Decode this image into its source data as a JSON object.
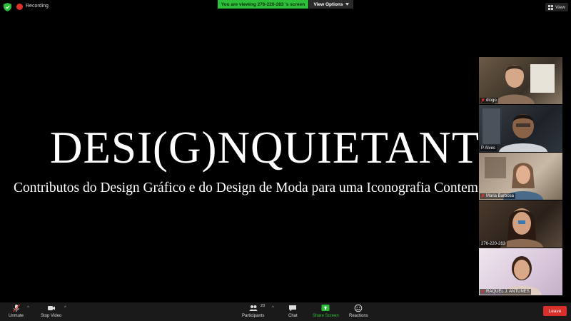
{
  "topbar": {
    "recording_label": "Recording",
    "viewing_banner": "You are viewing 276-220-283 's screen",
    "view_options_label": "View Options",
    "view_label": "View"
  },
  "shared_screen": {
    "title": "DESI(G)NQUIETANTE",
    "subtitle": "Contributos do Design Gráfico e do Design de Moda para uma Iconografia Contemporânea"
  },
  "participants": [
    {
      "name": "diogo",
      "muted": true
    },
    {
      "name": "P Alves",
      "muted": false
    },
    {
      "name": "Maria Barbosa",
      "muted": true
    },
    {
      "name": "276-220-283",
      "muted": false
    },
    {
      "name": "RAQUEL J. ANTUNES",
      "muted": true
    }
  ],
  "toolbar": {
    "unmute_label": "Unmute",
    "stop_video_label": "Stop Video",
    "participants_label": "Participants",
    "participants_count": "23",
    "chat_label": "Chat",
    "share_screen_label": "Share Screen",
    "reactions_label": "Reactions",
    "leave_label": "Leave"
  },
  "colors": {
    "share_green": "#2dbf3a",
    "leave_red": "#d9302b",
    "recording_red": "#e0322b"
  }
}
